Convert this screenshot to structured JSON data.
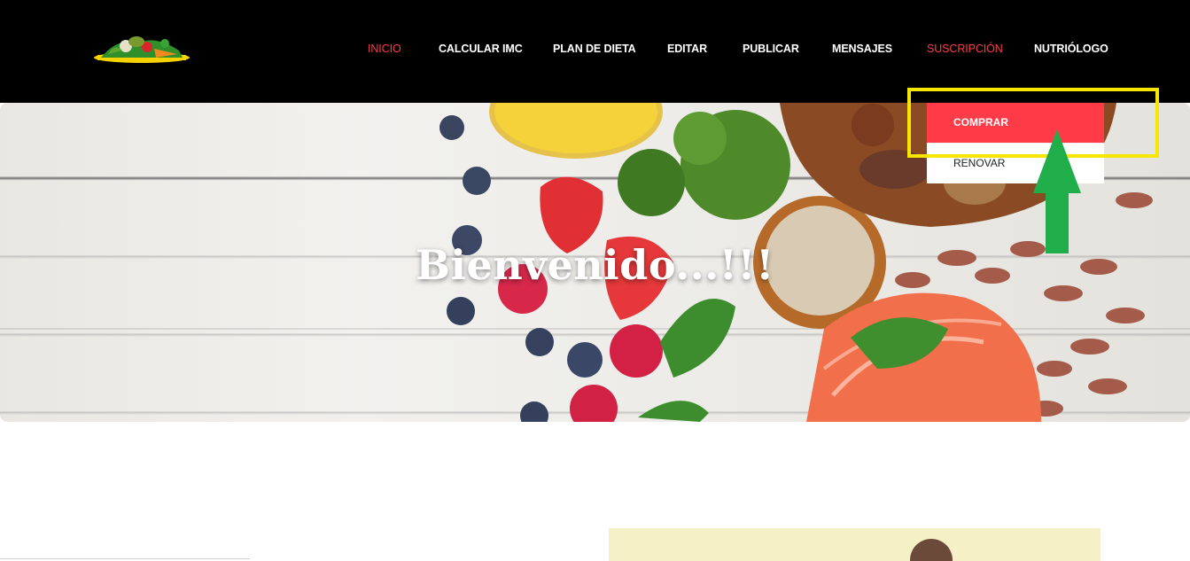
{
  "nav": {
    "items": [
      {
        "label": "INICIO"
      },
      {
        "label": "CALCULAR IMC"
      },
      {
        "label": "PLAN DE DIETA"
      },
      {
        "label": "EDITAR"
      },
      {
        "label": "PUBLICAR"
      },
      {
        "label": "MENSAJES"
      },
      {
        "label": "SUSCRIPCIÓN"
      },
      {
        "label": "NUTRIÓLOGO"
      }
    ]
  },
  "dropdown": {
    "items": [
      {
        "label": "COMPRAR"
      },
      {
        "label": "RENOVAR"
      }
    ]
  },
  "hero": {
    "title": "Bienvenido...!!!"
  },
  "colors": {
    "accent": "#ff3b47",
    "header_bg": "#000000",
    "highlight": "#f7e600",
    "arrow": "#1fae4a"
  },
  "icons": {
    "logo": "vegetables-logo",
    "annotation": "arrow-up-icon"
  }
}
